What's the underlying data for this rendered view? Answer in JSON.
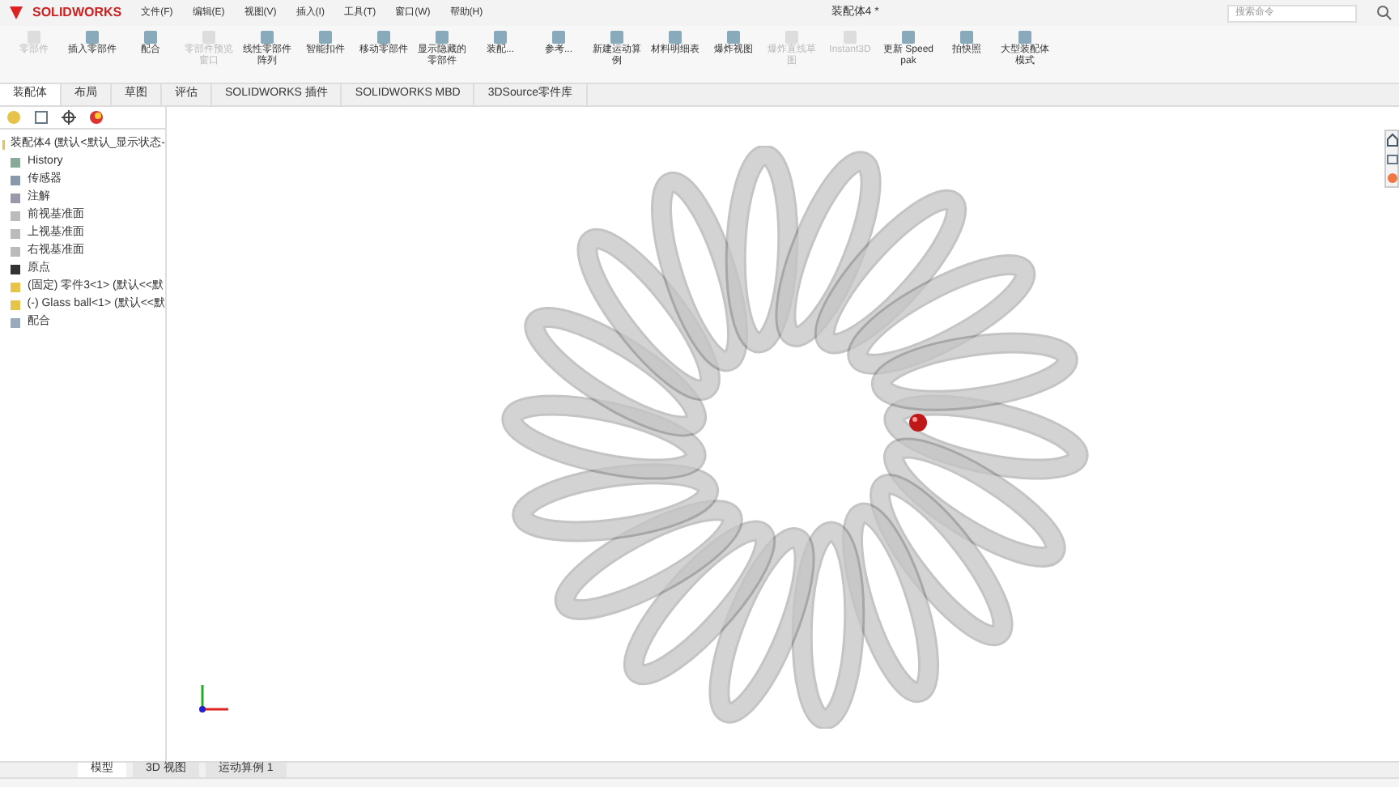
{
  "app": {
    "logo": "SOLIDWORKS",
    "title": "装配体4 *",
    "search": {
      "placeholder": "搜索命令"
    }
  },
  "menu": [
    "文件(F)",
    "编辑(E)",
    "视图(V)",
    "插入(I)",
    "工具(T)",
    "窗口(W)",
    "帮助(H)"
  ],
  "ribbon": [
    {
      "label": "零部件",
      "disabled": true
    },
    {
      "label": "插入零部件",
      "disabled": false
    },
    {
      "label": "配合",
      "disabled": false
    },
    {
      "label": "零部件预览窗口",
      "disabled": true
    },
    {
      "label": "线性零部件阵列",
      "disabled": false
    },
    {
      "label": "智能扣件",
      "disabled": false
    },
    {
      "label": "移动零部件",
      "disabled": false
    },
    {
      "label": "显示隐藏的零部件",
      "disabled": false
    },
    {
      "label": "装配...",
      "disabled": false
    },
    {
      "label": "参考...",
      "disabled": false
    },
    {
      "label": "新建运动算例",
      "disabled": false
    },
    {
      "label": "材料明细表",
      "disabled": false
    },
    {
      "label": "爆炸视图",
      "disabled": false
    },
    {
      "label": "爆炸直线草图",
      "disabled": true
    },
    {
      "label": "Instant3D",
      "disabled": true
    },
    {
      "label": "更新 Speedpak",
      "disabled": false
    },
    {
      "label": "拍快照",
      "disabled": false
    },
    {
      "label": "大型装配体模式",
      "disabled": false
    }
  ],
  "tabs": [
    {
      "label": "装配体",
      "selected": true
    },
    {
      "label": "布局",
      "selected": false
    },
    {
      "label": "草图",
      "selected": false
    },
    {
      "label": "评估",
      "selected": false
    },
    {
      "label": "SOLIDWORKS 插件",
      "selected": false
    },
    {
      "label": "SOLIDWORKS MBD",
      "selected": false
    },
    {
      "label": "3DSource零件库",
      "selected": false
    }
  ],
  "tree": {
    "label": "装配体4 (默认<默认_显示状态-",
    "children": [
      {
        "label": "History",
        "kind": "history"
      },
      {
        "label": "传感器",
        "kind": "sensor"
      },
      {
        "label": "注解",
        "kind": "annotation"
      },
      {
        "label": "前视基准面",
        "kind": "plane"
      },
      {
        "label": "上视基准面",
        "kind": "plane"
      },
      {
        "label": "右视基准面",
        "kind": "plane"
      },
      {
        "label": "原点",
        "kind": "origin"
      },
      {
        "label": "(固定) 零件3<1> (默认<<默",
        "kind": "part"
      },
      {
        "label": "(-) Glass ball<1> (默认<<默",
        "kind": "part"
      },
      {
        "label": "配合",
        "kind": "mate"
      }
    ]
  },
  "bottom_tabs": [
    {
      "label": "模型",
      "selected": true
    },
    {
      "label": "3D 视图",
      "selected": false
    },
    {
      "label": "运动算例 1",
      "selected": false
    }
  ]
}
